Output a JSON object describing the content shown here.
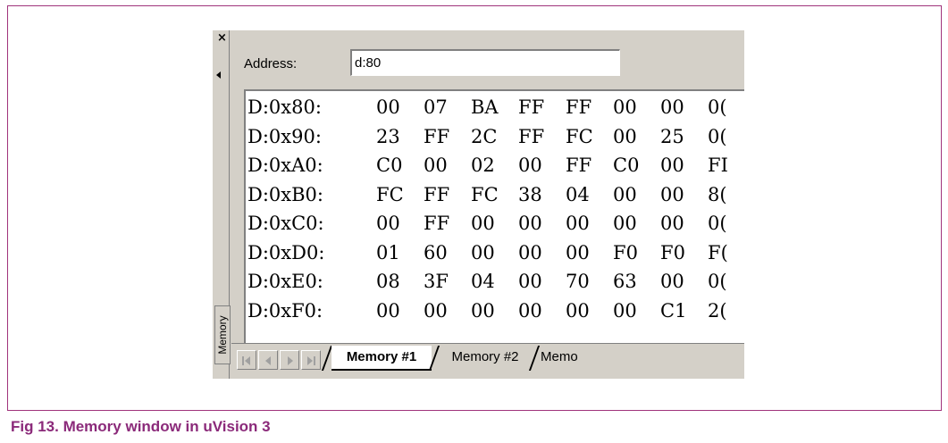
{
  "window": {
    "side_label": "Memory",
    "close_glyph": "×"
  },
  "address": {
    "label": "Address:",
    "value": "d:80"
  },
  "memory_rows": [
    {
      "addr": "D:0x80:",
      "bytes": [
        "00",
        "07",
        "BA",
        "FF",
        "FF",
        "00",
        "00",
        "0("
      ]
    },
    {
      "addr": "D:0x90:",
      "bytes": [
        "23",
        "FF",
        "2C",
        "FF",
        "FC",
        "00",
        "25",
        "0("
      ]
    },
    {
      "addr": "D:0xA0:",
      "bytes": [
        "C0",
        "00",
        "02",
        "00",
        "FF",
        "C0",
        "00",
        "FI"
      ]
    },
    {
      "addr": "D:0xB0:",
      "bytes": [
        "FC",
        "FF",
        "FC",
        "38",
        "04",
        "00",
        "00",
        "8("
      ]
    },
    {
      "addr": "D:0xC0:",
      "bytes": [
        "00",
        "FF",
        "00",
        "00",
        "00",
        "00",
        "00",
        "0("
      ]
    },
    {
      "addr": "D:0xD0:",
      "bytes": [
        "01",
        "60",
        "00",
        "00",
        "00",
        "F0",
        "F0",
        "F("
      ]
    },
    {
      "addr": "D:0xE0:",
      "bytes": [
        "08",
        "3F",
        "04",
        "00",
        "70",
        "63",
        "00",
        "0("
      ]
    },
    {
      "addr": "D:0xF0:",
      "bytes": [
        "00",
        "00",
        "00",
        "00",
        "00",
        "00",
        "C1",
        "2("
      ]
    }
  ],
  "tabs": [
    {
      "label": "Memory #1",
      "active": true
    },
    {
      "label": "Memory #2",
      "active": false
    },
    {
      "label": "Memo",
      "active": false
    }
  ],
  "caption": "Fig 13. Memory window in uVision 3",
  "colors": {
    "frame": "#a0347c",
    "caption": "#8b2a7a",
    "window_bg": "#d4d0c8"
  }
}
